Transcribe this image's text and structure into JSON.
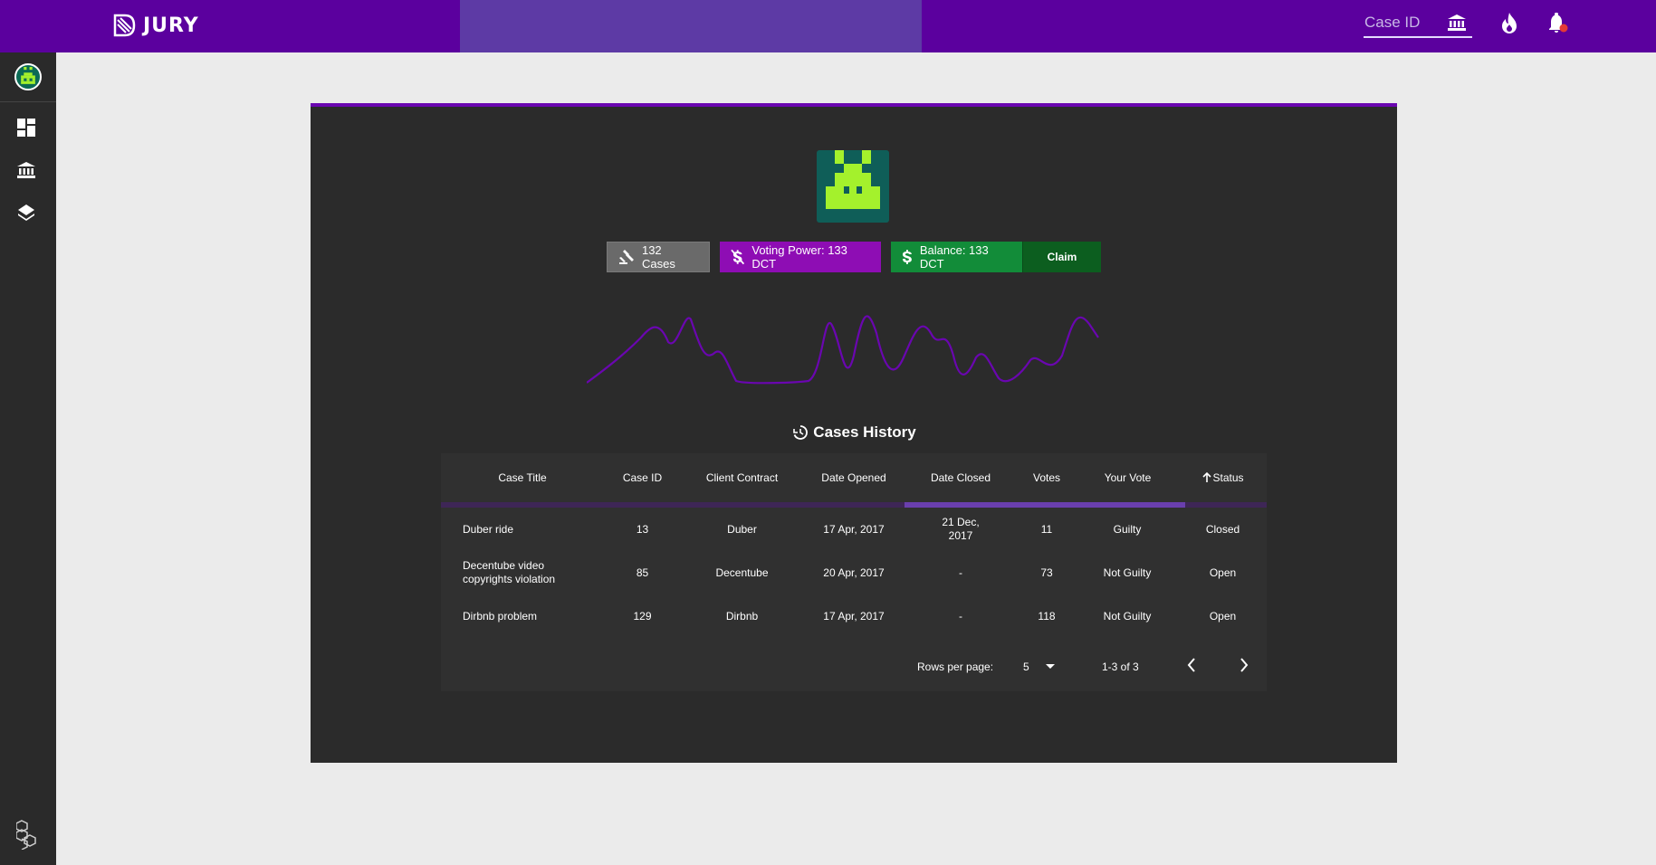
{
  "app": {
    "logo_text": "JURY"
  },
  "header": {
    "search_placeholder": "Case ID",
    "icons": [
      "bank-icon",
      "fire-icon",
      "bell-icon"
    ],
    "notification_dot_color": "#e53935"
  },
  "sidebar": {
    "items": [
      {
        "name": "avatar"
      },
      {
        "name": "dashboard-icon"
      },
      {
        "name": "bank-icon"
      },
      {
        "name": "layers-icon"
      },
      {
        "name": "blocks-icon"
      }
    ]
  },
  "profile": {
    "cases_chip": "132 Cases",
    "voting_power_chip": "Voting Power: 133 DCT",
    "balance_chip": "Balance: 133 DCT",
    "claim_button": "Claim"
  },
  "colors": {
    "brand": "#5b009e",
    "accent": "#6a06b0",
    "voting": "#8e0db4",
    "balance": "#128c39",
    "claim": "#0c5e1f",
    "avatar_green": "#a4f12c"
  },
  "history": {
    "title": "Cases History",
    "columns": [
      "Case Title",
      "Case ID",
      "Client Contract",
      "Date Opened",
      "Date Closed",
      "Votes",
      "Your Vote",
      "Status"
    ],
    "sorted_column": "Status",
    "loading_progress": 0.34,
    "rows": [
      {
        "title": "Duber ride",
        "id": "13",
        "contract": "Duber",
        "opened": "17 Apr, 2017",
        "closed": "21 Dec, 2017",
        "votes": "11",
        "your_vote": "Guilty",
        "status": "Closed"
      },
      {
        "title": "Decentube video copyrights violation",
        "id": "85",
        "contract": "Decentube",
        "opened": "20 Apr, 2017",
        "closed": "-",
        "votes": "73",
        "your_vote": "Not Guilty",
        "status": "Open"
      },
      {
        "title": "Dirbnb problem",
        "id": "129",
        "contract": "Dirbnb",
        "opened": "17 Apr, 2017",
        "closed": "-",
        "votes": "118",
        "your_vote": "Not Guilty",
        "status": "Open"
      }
    ],
    "rows_per_page_label": "Rows per page:",
    "rows_per_page": "5",
    "range": "1-3 of 3"
  }
}
